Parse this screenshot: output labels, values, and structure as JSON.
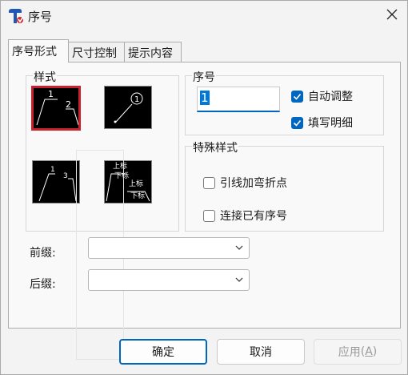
{
  "window": {
    "title": "序号"
  },
  "tabs": [
    {
      "label": "序号形式"
    },
    {
      "label": "尺寸控制"
    },
    {
      "label": "提示内容"
    }
  ],
  "style_group": {
    "legend": "样式",
    "options": [
      {
        "name": "style-1",
        "labels": [
          "1",
          "2"
        ],
        "selected": true
      },
      {
        "name": "style-2",
        "labels": [
          "1"
        ],
        "selected": false
      },
      {
        "name": "style-3",
        "labels": [
          "1",
          "3"
        ],
        "selected": false
      },
      {
        "name": "style-4",
        "labels": [
          "上标",
          "下标",
          "上标",
          "下标"
        ],
        "selected": false
      }
    ]
  },
  "number_group": {
    "legend": "序号",
    "value": "1",
    "auto_adjust": {
      "label": "自动调整",
      "checked": true
    },
    "fill_detail": {
      "label": "填写明细",
      "checked": true
    }
  },
  "special_group": {
    "legend": "特殊样式",
    "leader_bend": {
      "label": "引线加弯折点",
      "checked": false
    },
    "connect_existing": {
      "label": "连接已有序号",
      "checked": false
    }
  },
  "prefix": {
    "label": "前缀:",
    "value": ""
  },
  "suffix": {
    "label": "后缀:",
    "value": ""
  },
  "buttons": {
    "ok": "确定",
    "cancel": "取消",
    "apply": "应用",
    "apply_mnemonic": "A"
  },
  "colors": {
    "selection_border": "#c8232c",
    "accent": "#0067c0"
  }
}
